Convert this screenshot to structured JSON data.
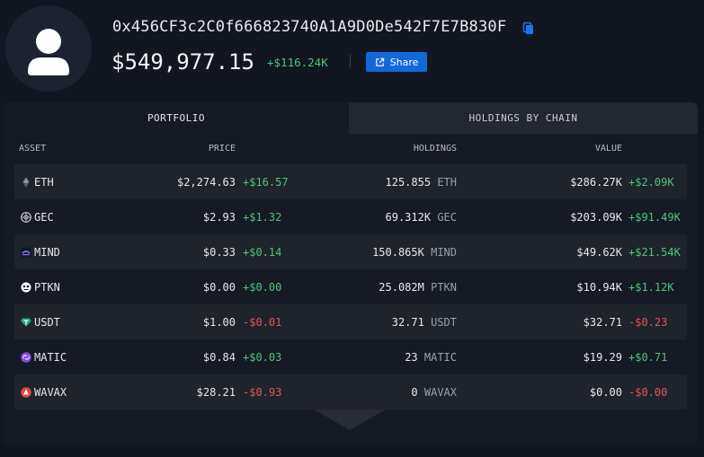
{
  "profile": {
    "address": "0x456CF3c2C0f666823740A1A9D0De542F7E7B830F",
    "balance": "$549,977.15",
    "change": "+$116.24K",
    "share_label": "Share"
  },
  "tabs": [
    {
      "label": "PORTFOLIO",
      "active": true
    },
    {
      "label": "HOLDINGS BY CHAIN",
      "active": false
    }
  ],
  "columns": {
    "asset": "ASSET",
    "price": "PRICE",
    "holdings": "HOLDINGS",
    "value": "VALUE"
  },
  "rows": [
    {
      "symbol": "ETH",
      "icon": "eth-icon",
      "price": "$2,274.63",
      "price_change": "+$16.57",
      "holdings": "125.855",
      "holdings_symbol": "ETH",
      "value": "$286.27K",
      "value_change": "+$2.09K"
    },
    {
      "symbol": "GEC",
      "icon": "gec-icon",
      "price": "$2.93",
      "price_change": "+$1.32",
      "holdings": "69.312K",
      "holdings_symbol": "GEC",
      "value": "$203.09K",
      "value_change": "+$91.49K"
    },
    {
      "symbol": "MIND",
      "icon": "mind-icon",
      "price": "$0.33",
      "price_change": "+$0.14",
      "holdings": "150.865K",
      "holdings_symbol": "MIND",
      "value": "$49.62K",
      "value_change": "+$21.54K"
    },
    {
      "symbol": "PTKN",
      "icon": "ptkn-icon",
      "price": "$0.00",
      "price_change": "+$0.00",
      "holdings": "25.082M",
      "holdings_symbol": "PTKN",
      "value": "$10.94K",
      "value_change": "+$1.12K"
    },
    {
      "symbol": "USDT",
      "icon": "usdt-icon",
      "price": "$1.00",
      "price_change": "-$0.01",
      "holdings": "32.71",
      "holdings_symbol": "USDT",
      "value": "$32.71",
      "value_change": "-$0.23"
    },
    {
      "symbol": "MATIC",
      "icon": "matic-icon",
      "price": "$0.84",
      "price_change": "+$0.03",
      "holdings": "23",
      "holdings_symbol": "MATIC",
      "value": "$19.29",
      "value_change": "+$0.71"
    },
    {
      "symbol": "WAVAX",
      "icon": "wavax-icon",
      "price": "$28.21",
      "price_change": "-$0.93",
      "holdings": "0",
      "holdings_symbol": "WAVAX",
      "value": "$0.00",
      "value_change": "-$0.00"
    }
  ],
  "colors": {
    "positive": "#52c27a",
    "negative": "#e15656",
    "accent": "#1268d9"
  }
}
